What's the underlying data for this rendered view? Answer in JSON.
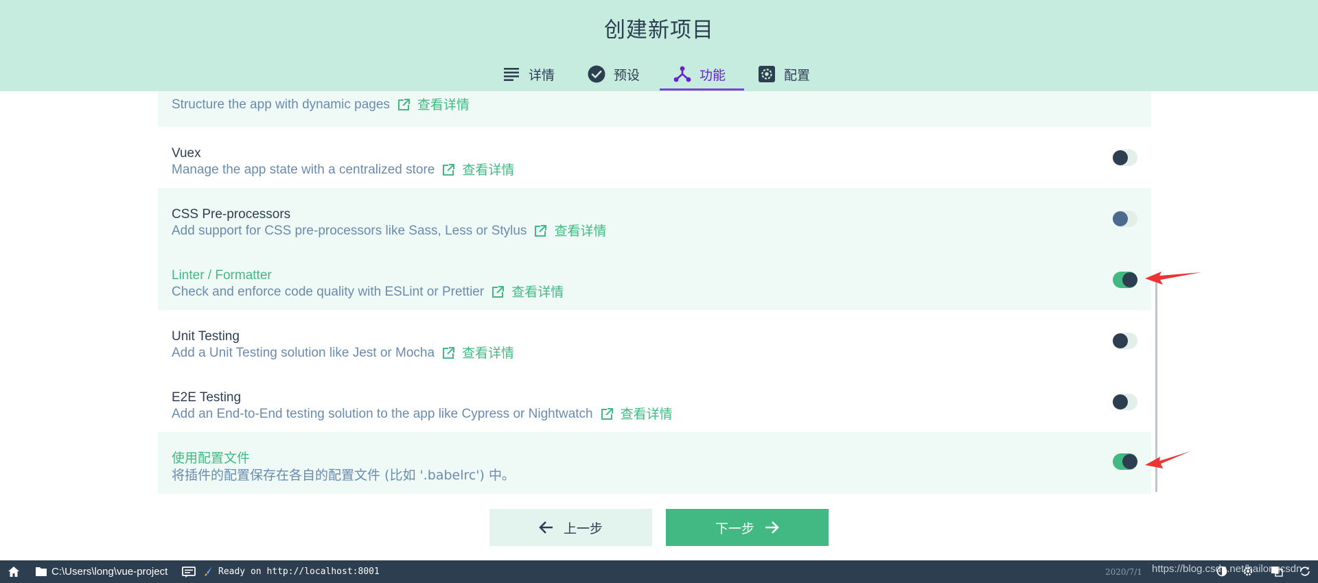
{
  "header": {
    "title": "创建新项目"
  },
  "tabs": [
    {
      "label": "详情",
      "icon": "list-icon"
    },
    {
      "label": "预设",
      "icon": "check-circle-icon"
    },
    {
      "label": "功能",
      "icon": "fork-icon"
    },
    {
      "label": "配置",
      "icon": "gear-icon"
    }
  ],
  "features": {
    "partial_desc": "Structure the app with dynamic pages",
    "more_label": "查看详情",
    "items": [
      {
        "name": "Vuex",
        "desc": "Manage the app state with a centralized store",
        "enabled": false
      },
      {
        "name": "CSS Pre-processors",
        "desc": "Add support for CSS pre-processors like Sass, Less or Stylus",
        "enabled": false
      },
      {
        "name": "Linter / Formatter",
        "desc": "Check and enforce code quality with ESLint or Prettier",
        "enabled": true
      },
      {
        "name": "Unit Testing",
        "desc": "Add a Unit Testing solution like Jest or Mocha",
        "enabled": false
      },
      {
        "name": "E2E Testing",
        "desc": "Add an End-to-End testing solution to the app like Cypress or Nightwatch",
        "enabled": false
      },
      {
        "name": "使用配置文件",
        "desc": "将插件的配置保存在各自的配置文件 (比如 '.babelrc') 中。",
        "enabled": true
      }
    ]
  },
  "buttons": {
    "prev": "上一步",
    "next": "下一步"
  },
  "statusbar": {
    "path": "C:\\Users\\long\\vue-project",
    "ready": "Ready on http://localhost:8001",
    "date": "2020/7/1",
    "url": "https://blog.csdn.net/hailongcsdn"
  },
  "colors": {
    "header_bg": "#c6ebdf",
    "accent": "#42b983",
    "active_tab": "#6a1ed2",
    "statusbar_bg": "#2c3e50"
  }
}
